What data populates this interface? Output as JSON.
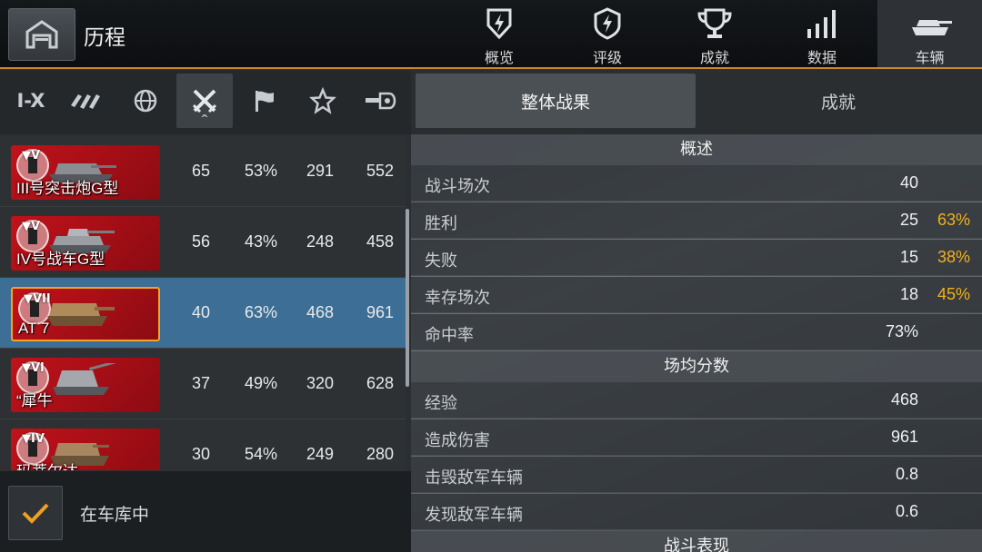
{
  "header": {
    "title": "历程",
    "home_icon": "garage-icon",
    "tabs": [
      {
        "label": "概览",
        "icon": "shield-bolt-icon",
        "active": false
      },
      {
        "label": "评级",
        "icon": "rating-shield-icon",
        "active": false
      },
      {
        "label": "成就",
        "icon": "trophy-icon",
        "active": false
      },
      {
        "label": "数据",
        "icon": "bar-stats-icon",
        "active": false
      },
      {
        "label": "车辆",
        "icon": "tank-icon",
        "active": true
      }
    ]
  },
  "filters": {
    "items": [
      {
        "label": "I-X",
        "icon": "tier-text",
        "active": false
      },
      {
        "label": "",
        "icon": "vehicle-class-icon",
        "active": false
      },
      {
        "label": "",
        "icon": "globe-icon",
        "active": false
      },
      {
        "label": "",
        "icon": "crossed-swords-icon",
        "active": true
      },
      {
        "label": "",
        "icon": "flag-icon",
        "active": false
      },
      {
        "label": "",
        "icon": "star-icon",
        "active": false
      },
      {
        "label": "",
        "icon": "tank-gun-icon",
        "active": false
      }
    ],
    "sort_caret": "^"
  },
  "tanks": [
    {
      "tier": "V",
      "name": "III号突击炮G型",
      "battles": "65",
      "winrate": "53%",
      "xp": "291",
      "damage": "552",
      "selected": false
    },
    {
      "tier": "V",
      "name": "IV号战车G型",
      "battles": "56",
      "winrate": "43%",
      "xp": "248",
      "damage": "458",
      "selected": false
    },
    {
      "tier": "VII",
      "name": "AT 7",
      "battles": "40",
      "winrate": "63%",
      "xp": "468",
      "damage": "961",
      "selected": true
    },
    {
      "tier": "VI",
      "name": "“犀牛",
      "battles": "37",
      "winrate": "49%",
      "xp": "320",
      "damage": "628",
      "selected": false
    },
    {
      "tier": "IV",
      "name": "玛蒂尔达",
      "battles": "30",
      "winrate": "54%",
      "xp": "249",
      "damage": "280",
      "selected": false
    }
  ],
  "garage_filter": {
    "checked": true,
    "label": "在车库中"
  },
  "right_tabs": [
    {
      "label": "整体战果",
      "active": true
    },
    {
      "label": "成就",
      "active": false
    }
  ],
  "sections": {
    "overview": {
      "title": "概述",
      "rows": [
        {
          "label": "战斗场次",
          "value": "40",
          "pct": ""
        },
        {
          "label": "胜利",
          "value": "25",
          "pct": "63%"
        },
        {
          "label": "失败",
          "value": "15",
          "pct": "38%"
        },
        {
          "label": "幸存场次",
          "value": "18",
          "pct": "45%"
        },
        {
          "label": "命中率",
          "value": "73%",
          "pct": ""
        }
      ]
    },
    "average": {
      "title": "场均分数",
      "rows": [
        {
          "label": "经验",
          "value": "468",
          "pct": ""
        },
        {
          "label": "造成伤害",
          "value": "961",
          "pct": ""
        },
        {
          "label": "击毁敌军车辆",
          "value": "0.8",
          "pct": ""
        },
        {
          "label": "发现敌军车辆",
          "value": "0.6",
          "pct": ""
        }
      ]
    },
    "performance": {
      "title": "战斗表现"
    }
  },
  "colors": {
    "accent": "#f0a021",
    "highlight_pct": "#f2b01c",
    "selected_row": "#3d6f96",
    "card_red": "#c1121a"
  }
}
